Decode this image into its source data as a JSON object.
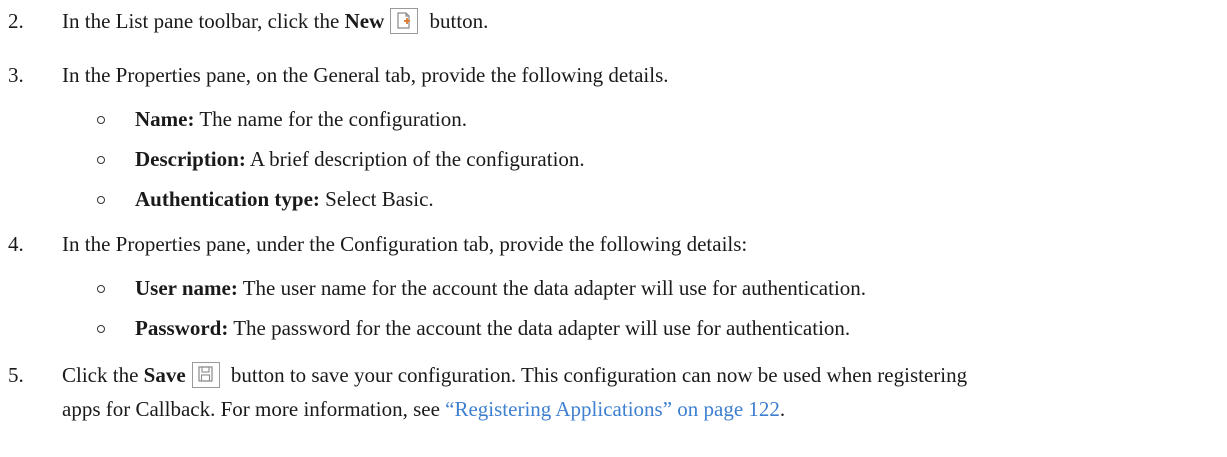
{
  "steps": [
    {
      "number": "2.",
      "pre": "In the List pane toolbar, click the ",
      "bold": "New",
      "post": " button.",
      "icon": "new-document-icon"
    },
    {
      "number": "3.",
      "text": "In the Properties pane, on the General tab, provide the following details.",
      "bullets": [
        {
          "label": "Name:",
          "text": " The name for the configuration."
        },
        {
          "label": "Description:",
          "text": " A brief description of the configuration."
        },
        {
          "label": "Authentication type:",
          "text": " Select Basic."
        }
      ]
    },
    {
      "number": "4.",
      "text": "In the Properties pane, under the Configuration tab, provide the following details:",
      "bullets": [
        {
          "label": "User name:",
          "text": " The user name for the account the data adapter will use for authentication."
        },
        {
          "label": "Password:",
          "text": " The password for the account the data adapter will use for authentication."
        }
      ]
    },
    {
      "number": "5.",
      "pre": "Click the ",
      "bold": "Save",
      "post": " button to save your configuration. This configuration can now be used when registering",
      "line2_pre": "apps for Callback. For more information, see ",
      "link": "“Registering Applications” on page 122",
      "line2_post": ".",
      "icon": "save-icon"
    }
  ],
  "colors": {
    "link": "#3d7fd0",
    "icon_accent": "#e07a2f"
  }
}
